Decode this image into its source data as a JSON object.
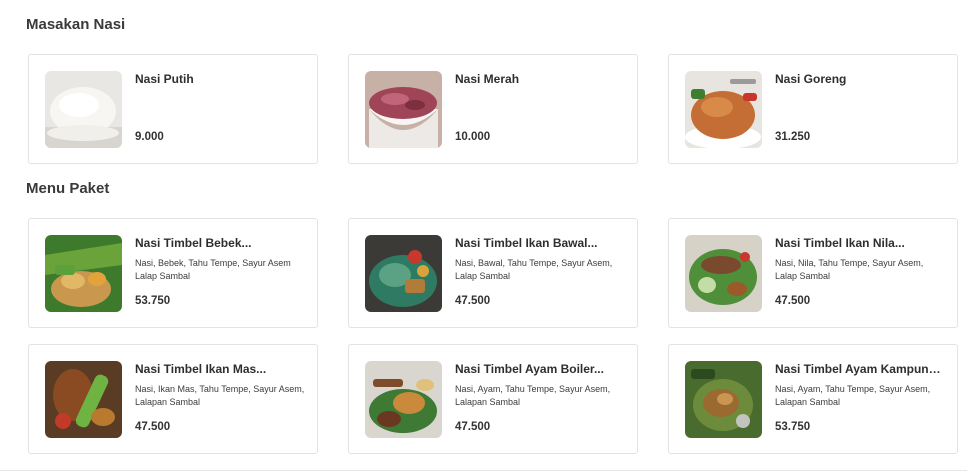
{
  "sections": [
    {
      "title": "Masakan Nasi",
      "items": [
        {
          "name": "Nasi Putih",
          "description": "",
          "price": "9.000",
          "image": "white-rice-image"
        },
        {
          "name": "Nasi Merah",
          "description": "",
          "price": "10.000",
          "image": "red-rice-image"
        },
        {
          "name": "Nasi Goreng",
          "description": "",
          "price": "31.250",
          "image": "fried-rice-image"
        }
      ]
    },
    {
      "title": "Menu Paket",
      "items": [
        {
          "name": "Nasi Timbel Bebek...",
          "description": "Nasi, Bebek, Tahu Tempe, Sayur Asem Lalap Sambal",
          "price": "53.750",
          "image": "timbel-duck-image"
        },
        {
          "name": "Nasi Timbel Ikan Bawal...",
          "description": "Nasi, Bawal, Tahu Tempe, Sayur Asem, Lalap Sambal",
          "price": "47.500",
          "image": "timbel-pomfret-image"
        },
        {
          "name": "Nasi Timbel Ikan Nila...",
          "description": "Nasi, Nila, Tahu Tempe, Sayur Asem, Lalap Sambal",
          "price": "47.500",
          "image": "timbel-tilapia-image"
        },
        {
          "name": "Nasi Timbel Ikan Mas...",
          "description": "Nasi, Ikan Mas, Tahu Tempe, Sayur Asem, Lalapan Sambal",
          "price": "47.500",
          "image": "timbel-carp-image"
        },
        {
          "name": "Nasi Timbel Ayam Boiler...",
          "description": "Nasi, Ayam, Tahu Tempe, Sayur Asem, Lalapan Sambal",
          "price": "47.500",
          "image": "timbel-broiler-chicken-image"
        },
        {
          "name": "Nasi Timbel Ayam Kampung...",
          "description": "Nasi, Ayam, Tahu Tempe, Sayur Asem, Lalapan Sambal",
          "price": "53.750",
          "image": "timbel-village-chicken-image"
        }
      ]
    }
  ]
}
